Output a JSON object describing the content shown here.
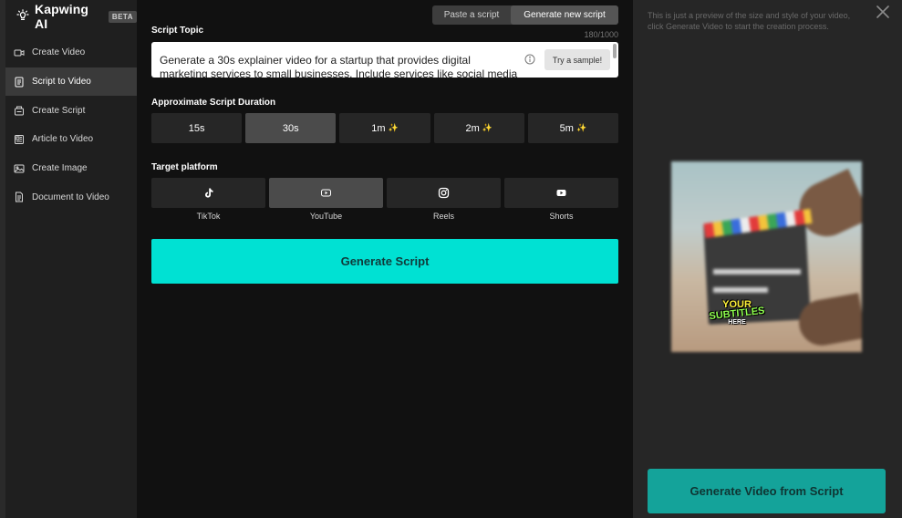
{
  "brand": {
    "name": "Kapwing AI",
    "badge": "BETA"
  },
  "sidebar": {
    "items": [
      {
        "label": "Create Video",
        "icon": "video-camera-icon"
      },
      {
        "label": "Script to Video",
        "icon": "script-icon",
        "active": true
      },
      {
        "label": "Create Script",
        "icon": "script-generate-icon"
      },
      {
        "label": "Article to Video",
        "icon": "article-icon"
      },
      {
        "label": "Create Image",
        "icon": "image-icon"
      },
      {
        "label": "Document to Video",
        "icon": "document-icon"
      }
    ]
  },
  "mode_toggle": {
    "paste": "Paste a script",
    "generate": "Generate new script",
    "selected": "generate"
  },
  "script_topic": {
    "label": "Script Topic",
    "counter": "180/1000",
    "value": "Generate a 30s explainer video for a startup that provides digital marketing services to small businesses. Include services like social media",
    "sample_button": "Try a sample!"
  },
  "duration": {
    "label": "Approximate Script Duration",
    "options": [
      "15s",
      "30s",
      "1m",
      "2m",
      "5m"
    ],
    "premium": [
      false,
      false,
      true,
      true,
      true
    ],
    "selected": "30s",
    "spark_glyph": "✨"
  },
  "platform": {
    "label": "Target platform",
    "options": [
      {
        "label": "TikTok",
        "icon": "tiktok-icon"
      },
      {
        "label": "YouTube",
        "icon": "youtube-icon",
        "selected": true
      },
      {
        "label": "Reels",
        "icon": "instagram-icon"
      },
      {
        "label": "Shorts",
        "icon": "youtube-shorts-icon"
      }
    ]
  },
  "generate_script_button": "Generate Script",
  "preview": {
    "note": "This is just a preview of the size and style of your video, click Generate Video to start the creation process.",
    "subtitle_lines": [
      "YOUR",
      "SUBTITLES",
      "HERE"
    ],
    "generate_video_button": "Generate Video from Script"
  },
  "colors": {
    "accent": "#00e1d3",
    "accent_dark": "#14a39a",
    "selected_bg": "#4b4b4b",
    "sidebar_bg": "#1f1f1f"
  }
}
